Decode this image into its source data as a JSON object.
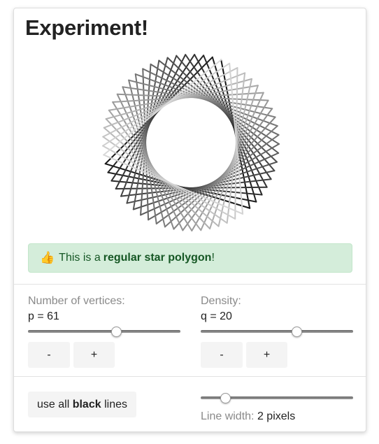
{
  "title": "Experiment!",
  "star": {
    "p": 61,
    "q": 20,
    "line_width": 2
  },
  "alert": {
    "emoji": "👍",
    "prefix": "This is a",
    "bold": "regular star polygon",
    "suffix": "!",
    "background": "#d4edda",
    "text_color": "#155724"
  },
  "vertices": {
    "label": "Number of vertices:",
    "value_text": "p = 61",
    "slider_fraction": 0.58,
    "minus": "-",
    "plus": "+"
  },
  "density": {
    "label": "Density:",
    "value_text": "q = 20",
    "slider_fraction": 0.63,
    "minus": "-",
    "plus": "+"
  },
  "black_button": {
    "prefix": "use all",
    "bold": "black",
    "suffix": "lines"
  },
  "line_width": {
    "label": "Line width:",
    "value_text": "2 pixels",
    "slider_fraction": 0.16
  }
}
